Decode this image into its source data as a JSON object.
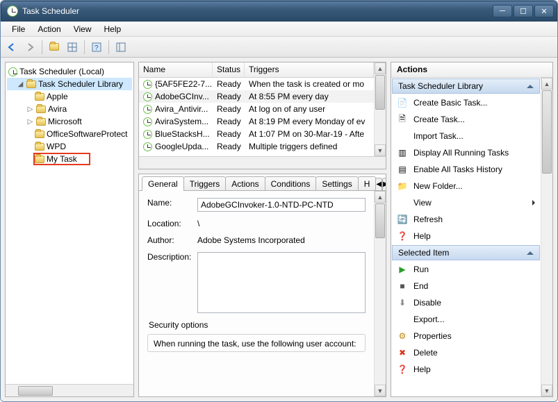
{
  "window": {
    "title": "Task Scheduler"
  },
  "menu": {
    "file": "File",
    "action": "Action",
    "view": "View",
    "help": "Help"
  },
  "tree": {
    "root": "Task Scheduler (Local)",
    "library": "Task Scheduler Library",
    "items": [
      "Apple",
      "Avira",
      "Microsoft",
      "OfficeSoftwareProtect",
      "WPD",
      "My Task"
    ]
  },
  "list": {
    "cols": {
      "name": "Name",
      "status": "Status",
      "triggers": "Triggers"
    },
    "rows": [
      {
        "name": "{5AF5FE22-7...",
        "status": "Ready",
        "trigger": "When the task is created or mo"
      },
      {
        "name": "AdobeGCInv...",
        "status": "Ready",
        "trigger": "At 8:55 PM every day"
      },
      {
        "name": "Avira_Antivir...",
        "status": "Ready",
        "trigger": "At log on of any user"
      },
      {
        "name": "AviraSystem...",
        "status": "Ready",
        "trigger": "At 8:19 PM every Monday of ev"
      },
      {
        "name": "BlueStacksH...",
        "status": "Ready",
        "trigger": "At 1:07 PM on 30-Mar-19 - Afte"
      },
      {
        "name": "GoogleUpda...",
        "status": "Ready",
        "trigger": "Multiple triggers defined"
      }
    ]
  },
  "tabs": {
    "general": "General",
    "triggers": "Triggers",
    "actions": "Actions",
    "conditions": "Conditions",
    "settings": "Settings",
    "history": "H"
  },
  "details": {
    "name_label": "Name:",
    "name_value": "AdobeGCInvoker-1.0-NTD-PC-NTD",
    "location_label": "Location:",
    "location_value": "\\",
    "author_label": "Author:",
    "author_value": "Adobe Systems Incorporated",
    "description_label": "Description:",
    "security_title": "Security options",
    "security_text": "When running the task, use the following user account:"
  },
  "actions": {
    "header": "Actions",
    "group1": "Task Scheduler Library",
    "items1": [
      {
        "icon": "📄",
        "label": "Create Basic Task..."
      },
      {
        "icon": "🗎",
        "label": "Create Task..."
      },
      {
        "icon": "",
        "label": "Import Task..."
      },
      {
        "icon": "▥",
        "label": "Display All Running Tasks"
      },
      {
        "icon": "▤",
        "label": "Enable All Tasks History"
      },
      {
        "icon": "📁",
        "label": "New Folder..."
      },
      {
        "icon": "",
        "label": "View",
        "submenu": true
      },
      {
        "icon": "🔄",
        "label": "Refresh"
      },
      {
        "icon": "❓",
        "label": "Help"
      }
    ],
    "group2": "Selected Item",
    "items2": [
      {
        "icon": "▶",
        "color": "#2a9d2a",
        "label": "Run"
      },
      {
        "icon": "■",
        "color": "#555",
        "label": "End"
      },
      {
        "icon": "⬇",
        "color": "#888",
        "label": "Disable"
      },
      {
        "icon": "",
        "label": "Export..."
      },
      {
        "icon": "⚙",
        "color": "#b8860b",
        "label": "Properties"
      },
      {
        "icon": "✖",
        "color": "#d63a1e",
        "label": "Delete"
      },
      {
        "icon": "❓",
        "label": "Help"
      }
    ]
  }
}
